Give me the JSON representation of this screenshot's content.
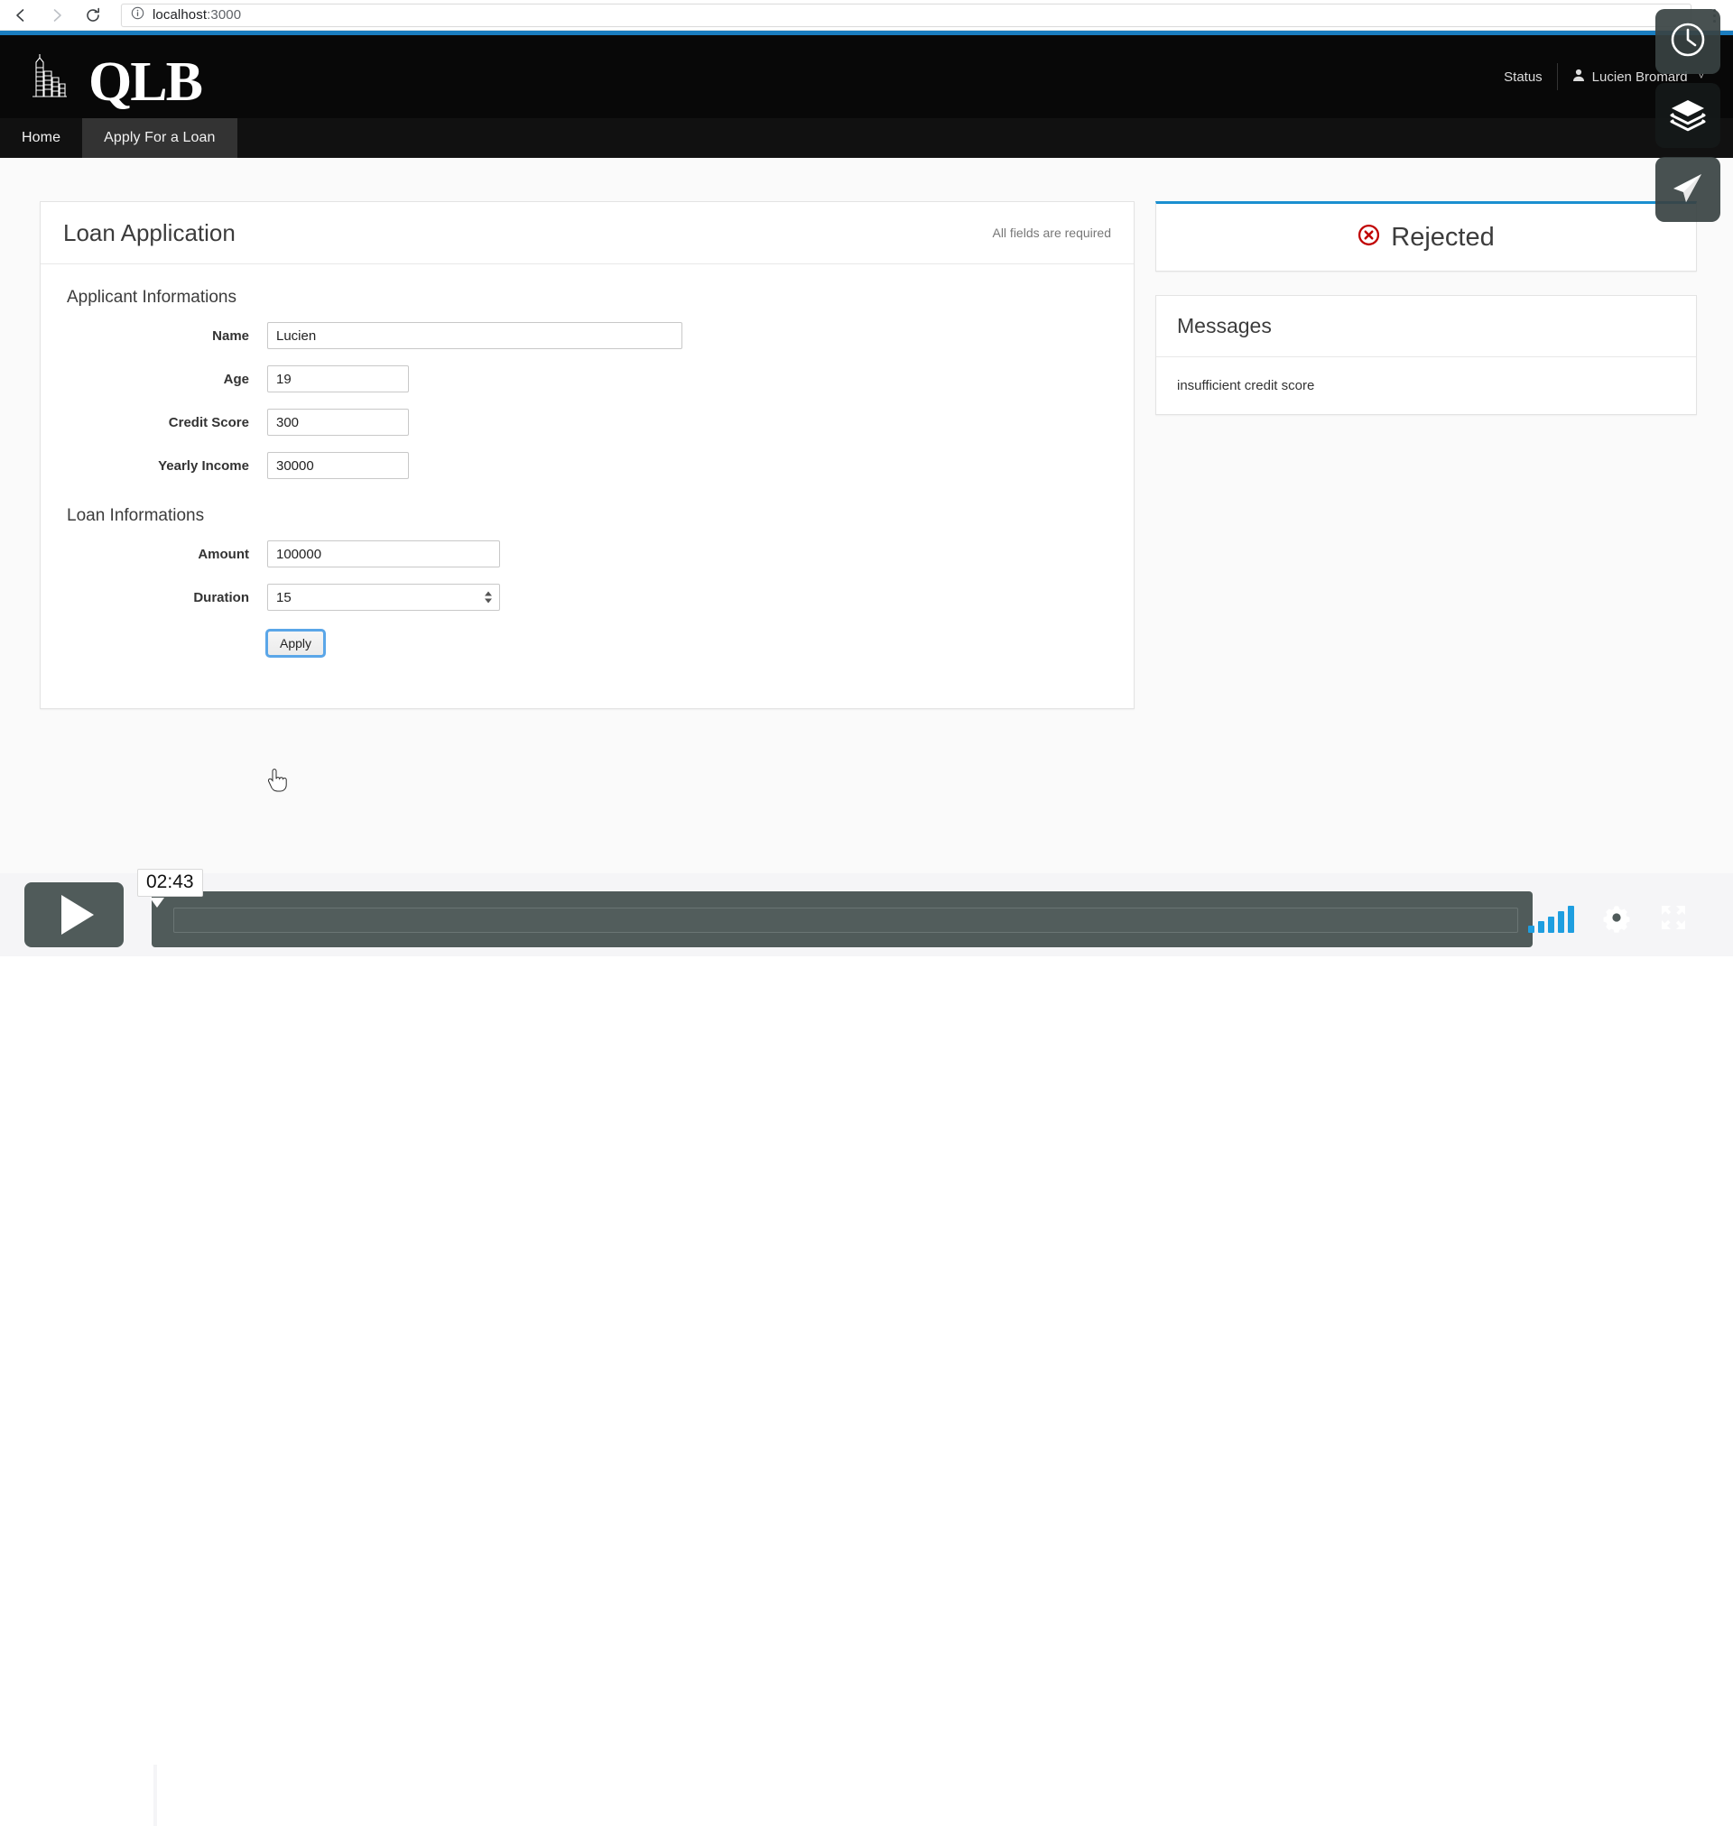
{
  "browser": {
    "back_icon": "back-arrow-icon",
    "forward_icon": "forward-arrow-icon",
    "reload_icon": "reload-icon",
    "info_icon": "info-icon",
    "url_host": "localhost",
    "url_port": ":3000",
    "menu_icon": "kebab-menu-icon"
  },
  "header": {
    "brand": "QLB",
    "logo_icon": "city-skyline-icon",
    "status_label": "Status",
    "user_icon": "user-icon",
    "user_name": "Lucien Bromard",
    "chevron": "˅",
    "accent_color": "#1a7dc0"
  },
  "nav": {
    "tabs": [
      {
        "label": "Home",
        "active": false
      },
      {
        "label": "Apply For a Loan",
        "active": true
      }
    ]
  },
  "form_card": {
    "title": "Loan Application",
    "required_note": "All fields are required",
    "applicant_section": "Applicant Informations",
    "loan_section": "Loan Informations",
    "fields": {
      "name_label": "Name",
      "name_value": "Lucien",
      "age_label": "Age",
      "age_value": "19",
      "credit_label": "Credit Score",
      "credit_value": "300",
      "income_label": "Yearly Income",
      "income_value": "30000",
      "amount_label": "Amount",
      "amount_value": "100000",
      "duration_label": "Duration",
      "duration_value": "15"
    },
    "apply_label": "Apply"
  },
  "status_panel": {
    "status_icon": "rejected-circle-x-icon",
    "status_text": "Rejected",
    "status_color": "#c00000",
    "top_border_color": "#1a8fd0"
  },
  "messages_panel": {
    "title": "Messages",
    "items": [
      {
        "text": "insufficient credit score"
      }
    ]
  },
  "overlay_buttons": [
    {
      "icon": "clock-icon",
      "name": "history-button"
    },
    {
      "icon": "layers-icon",
      "name": "layers-button"
    },
    {
      "icon": "send-icon",
      "name": "send-button"
    }
  ],
  "player": {
    "play_icon": "play-icon",
    "current_time": "02:43",
    "signal_icon": "signal-bars-icon",
    "settings_icon": "gear-icon",
    "fullscreen_icon": "fullscreen-icon"
  }
}
